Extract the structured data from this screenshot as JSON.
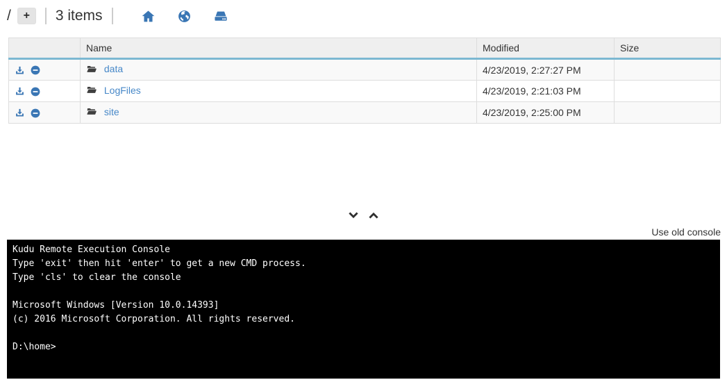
{
  "topbar": {
    "path_label": "/",
    "new_item_label": "+",
    "item_count": "3 items",
    "icons": [
      "home-icon",
      "globe-icon",
      "drive-icon"
    ]
  },
  "table": {
    "headers": {
      "actions": "",
      "name": "Name",
      "modified": "Modified",
      "size": "Size"
    },
    "rows": [
      {
        "name": "data",
        "modified": "4/23/2019, 2:27:27 PM",
        "size": "",
        "icons": [
          "download-icon",
          "minus-circle-icon",
          "folder-icon"
        ]
      },
      {
        "name": "LogFiles",
        "modified": "4/23/2019, 2:21:03 PM",
        "size": "",
        "icons": [
          "download-icon",
          "minus-circle-icon",
          "folder-icon"
        ]
      },
      {
        "name": "site",
        "modified": "4/23/2019, 2:25:00 PM",
        "size": "",
        "icons": [
          "download-icon",
          "minus-circle-icon",
          "folder-icon"
        ]
      }
    ]
  },
  "resize_controls": {
    "icons": [
      "chevron-down-icon",
      "chevron-up-icon"
    ]
  },
  "console_panel": {
    "use_old_console_label": "Use old console",
    "lines": [
      "Kudu Remote Execution Console",
      "Type 'exit' then hit 'enter' to get a new CMD process.",
      "Type 'cls' to clear the console",
      "",
      "Microsoft Windows [Version 10.0.14393]",
      "(c) 2016 Microsoft Corporation. All rights reserved.",
      "",
      "D:\\home>"
    ]
  },
  "colors": {
    "accent_blue": "#3a76b4",
    "link_blue": "#4788c8",
    "header_divider_blue": "#7cb8d2",
    "header_bg": "#efefef",
    "stripe_bg": "#f9f9f9",
    "console_bg": "#000000",
    "console_text": "#ffffff"
  }
}
